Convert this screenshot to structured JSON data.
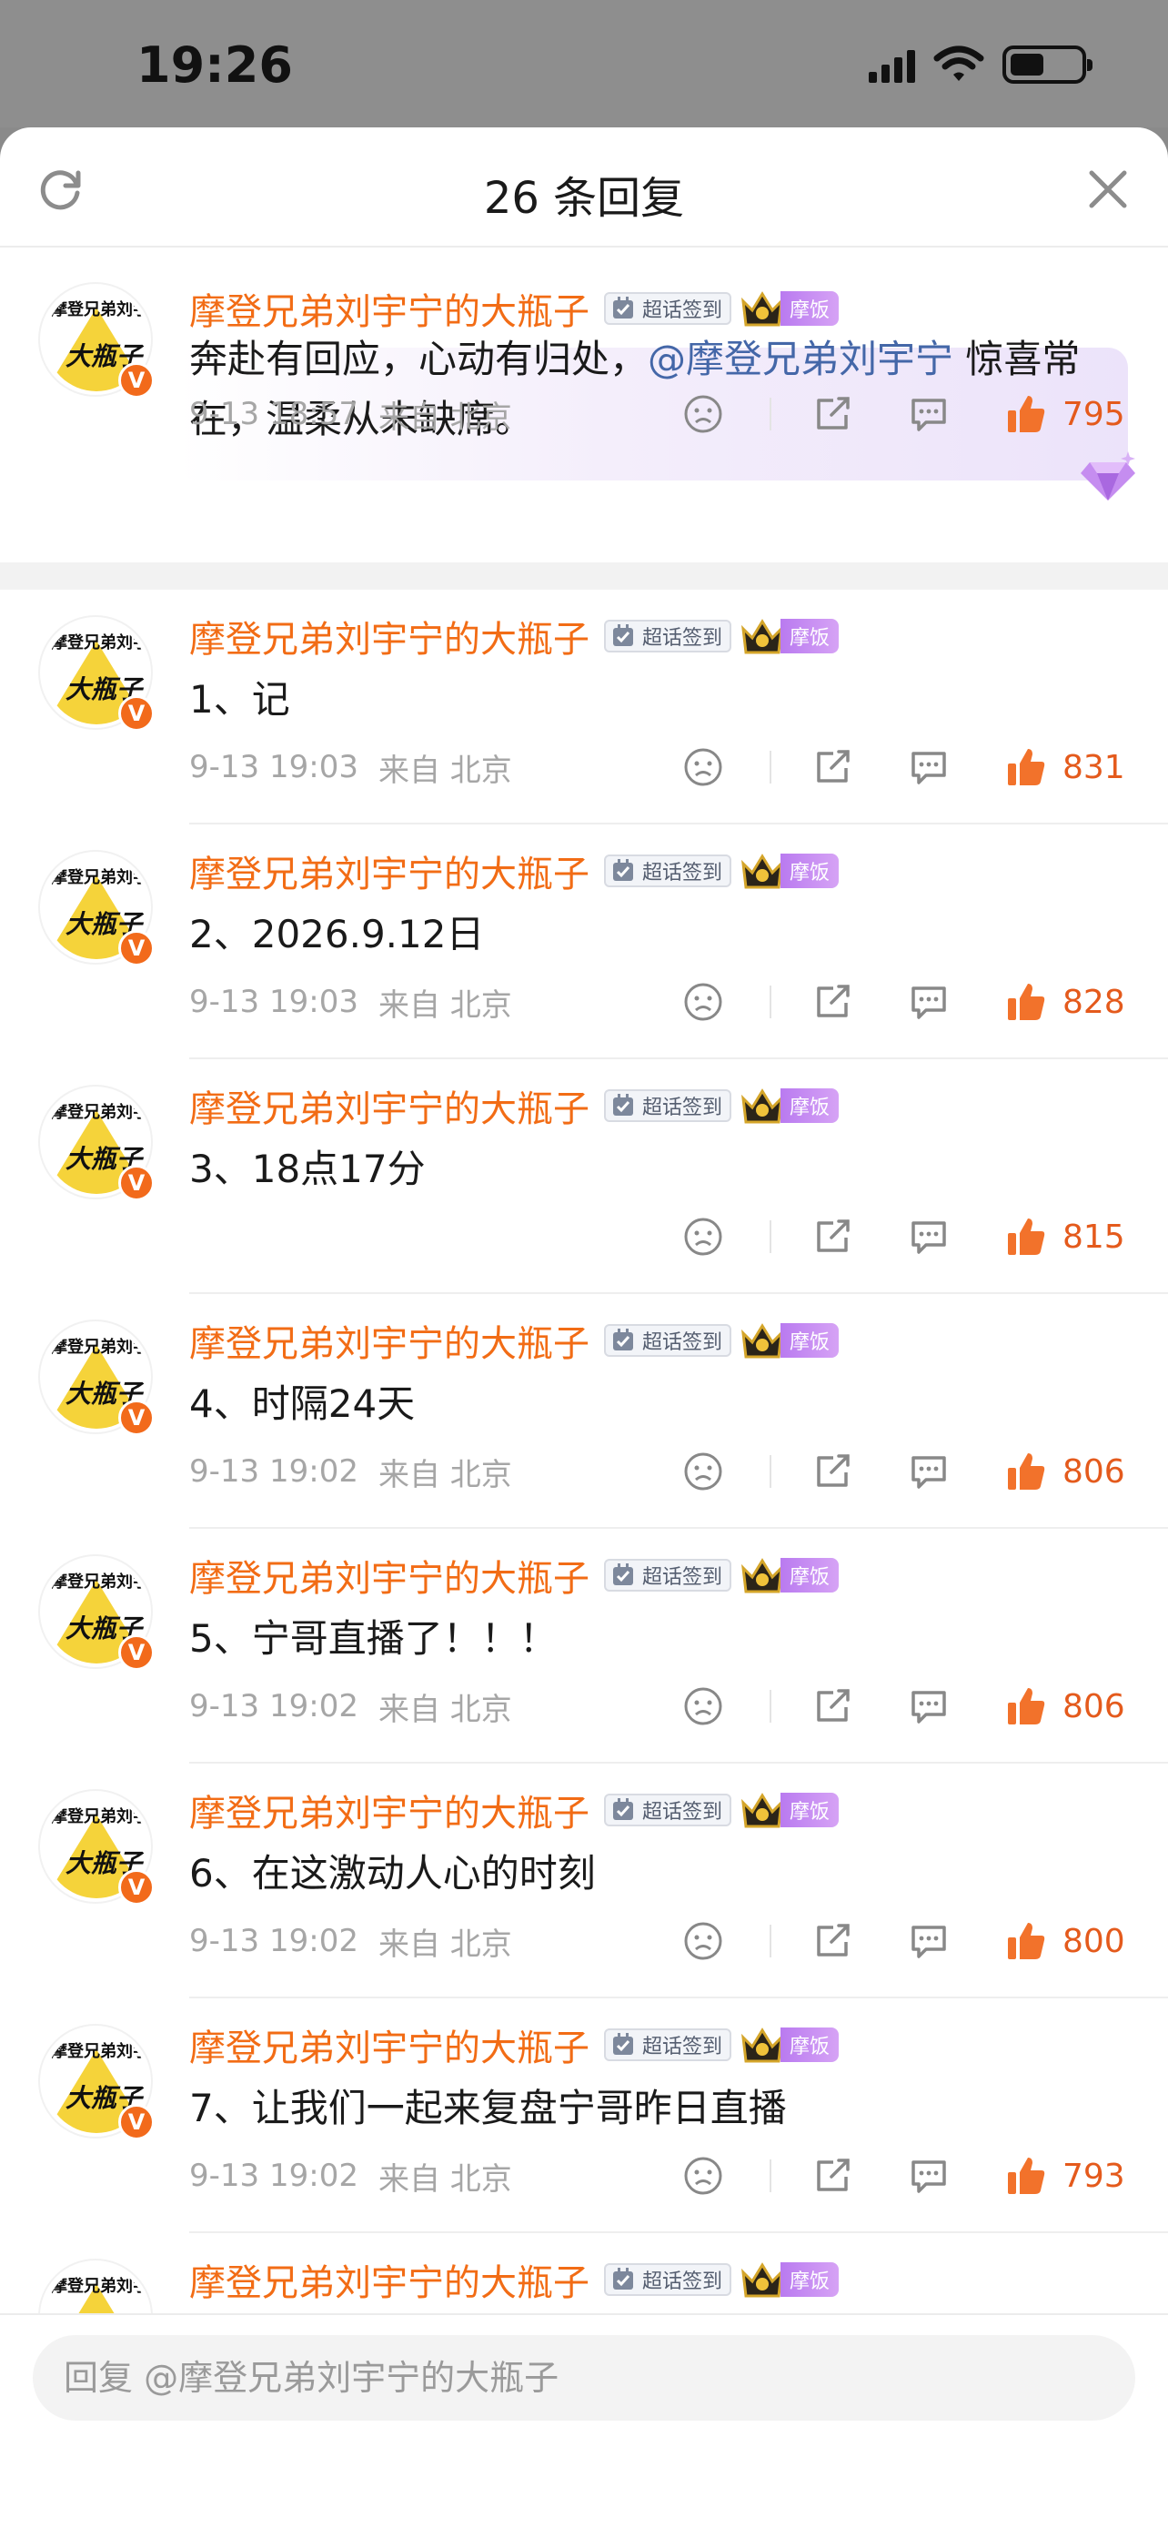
{
  "status_bar": {
    "time": "19:26"
  },
  "header": {
    "title": "26 条回复"
  },
  "badges": {
    "checkin": "超话签到",
    "fan": "摩饭"
  },
  "avatar": {
    "top_text": "摩登兄弟刘宇宁",
    "mid_text": "大瓶子",
    "v_mark": "V"
  },
  "comments": [
    {
      "user": "摩登兄弟刘宇宁的大瓶子",
      "text_a": "奔赴有回应，心动有归处，",
      "mention": "@摩登兄弟刘宇宁",
      "text_b": " 惊喜常在，温柔从未缺席。",
      "time": "9-13 18:57",
      "source": "来自 北京",
      "likes": "795"
    },
    {
      "user": "摩登兄弟刘宇宁的大瓶子",
      "text": "1、记",
      "time": "9-13 19:03",
      "source": "来自 北京",
      "likes": "831"
    },
    {
      "user": "摩登兄弟刘宇宁的大瓶子",
      "text": "2、2026.9.12日",
      "time": "9-13 19:03",
      "source": "来自 北京",
      "likes": "828"
    },
    {
      "user": "摩登兄弟刘宇宁的大瓶子",
      "text": "3、18点17分",
      "time": "",
      "source": "",
      "likes": "815"
    },
    {
      "user": "摩登兄弟刘宇宁的大瓶子",
      "text": "4、时隔24天",
      "time": "9-13 19:02",
      "source": "来自 北京",
      "likes": "806"
    },
    {
      "user": "摩登兄弟刘宇宁的大瓶子",
      "text": "5、宁哥直播了！！！",
      "time": "9-13 19:02",
      "source": "来自 北京",
      "likes": "806"
    },
    {
      "user": "摩登兄弟刘宇宁的大瓶子",
      "text": "6、在这激动人心的时刻",
      "time": "9-13 19:02",
      "source": "来自 北京",
      "likes": "800"
    },
    {
      "user": "摩登兄弟刘宇宁的大瓶子",
      "text": "7、让我们一起来复盘宁哥昨日直播",
      "time": "9-13 19:02",
      "source": "来自 北京",
      "likes": "793"
    },
    {
      "user": "摩登兄弟刘宇宁的大瓶子"
    }
  ],
  "reply": {
    "placeholder": "回复 @摩登兄弟刘宇宁的大瓶子"
  }
}
